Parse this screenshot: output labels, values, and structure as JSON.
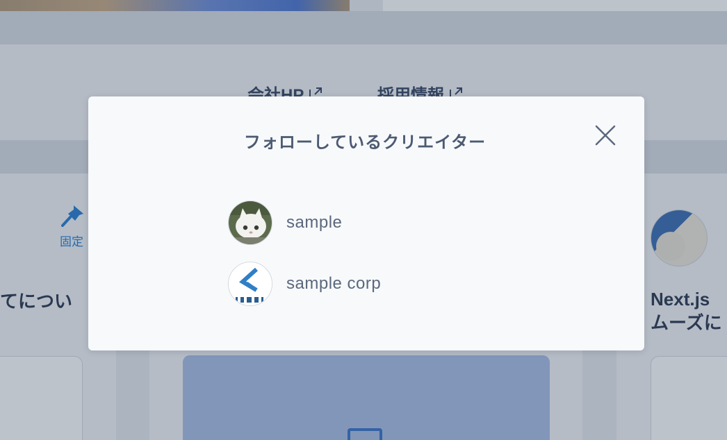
{
  "background": {
    "footer_links": [
      {
        "label": "会社HP"
      },
      {
        "label": "採用情報"
      }
    ],
    "pinned_label": "固定",
    "left_card_title": "てについ",
    "right_card_title_line1": "Next.js",
    "right_card_title_line2": "ムーズに"
  },
  "modal": {
    "title": "フォローしているクリエイター",
    "close_icon": "close-icon",
    "creators": [
      {
        "name": "sample",
        "avatar": "cat-photo-avatar"
      },
      {
        "name": "sample corp",
        "avatar": "corp-logo-avatar"
      }
    ]
  },
  "colors": {
    "accent": "#2a7fd1",
    "text_dark": "#2d3a52",
    "modal_text": "#5b687c",
    "overlay": "rgba(38,55,82,0.30)"
  }
}
